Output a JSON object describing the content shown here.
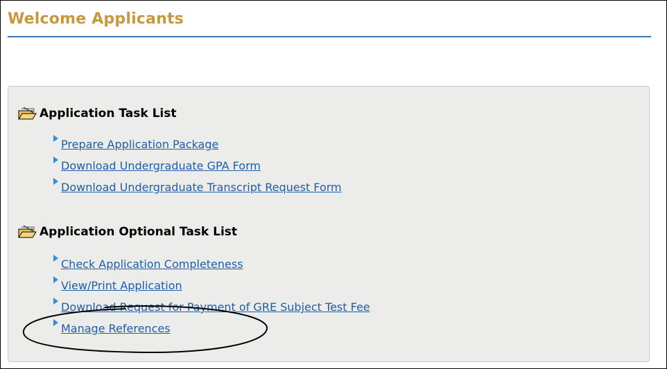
{
  "page": {
    "title": "Welcome Applicants"
  },
  "sections": [
    {
      "title": "Application Task List",
      "icon": "folder-open-icon",
      "items": [
        {
          "label": "Prepare Application Package"
        },
        {
          "label": "Download Undergraduate GPA Form"
        },
        {
          "label": "Download Undergraduate Transcript Request Form"
        }
      ]
    },
    {
      "title": "Application Optional Task List",
      "icon": "folder-open-icon",
      "items": [
        {
          "label": "Check Application Completeness"
        },
        {
          "label": "View/Print Application"
        },
        {
          "label": "Download Request for Payment of GRE Subject Test Fee"
        },
        {
          "label": "Manage References"
        }
      ]
    }
  ],
  "colors": {
    "title": "#c8993c",
    "rule": "#3a78b5",
    "link": "#1d5ea8",
    "panel": "#ececea",
    "arrow": "#2f8fd8"
  },
  "annotation": {
    "type": "hand-drawn-ellipse",
    "target": "Manage References"
  }
}
